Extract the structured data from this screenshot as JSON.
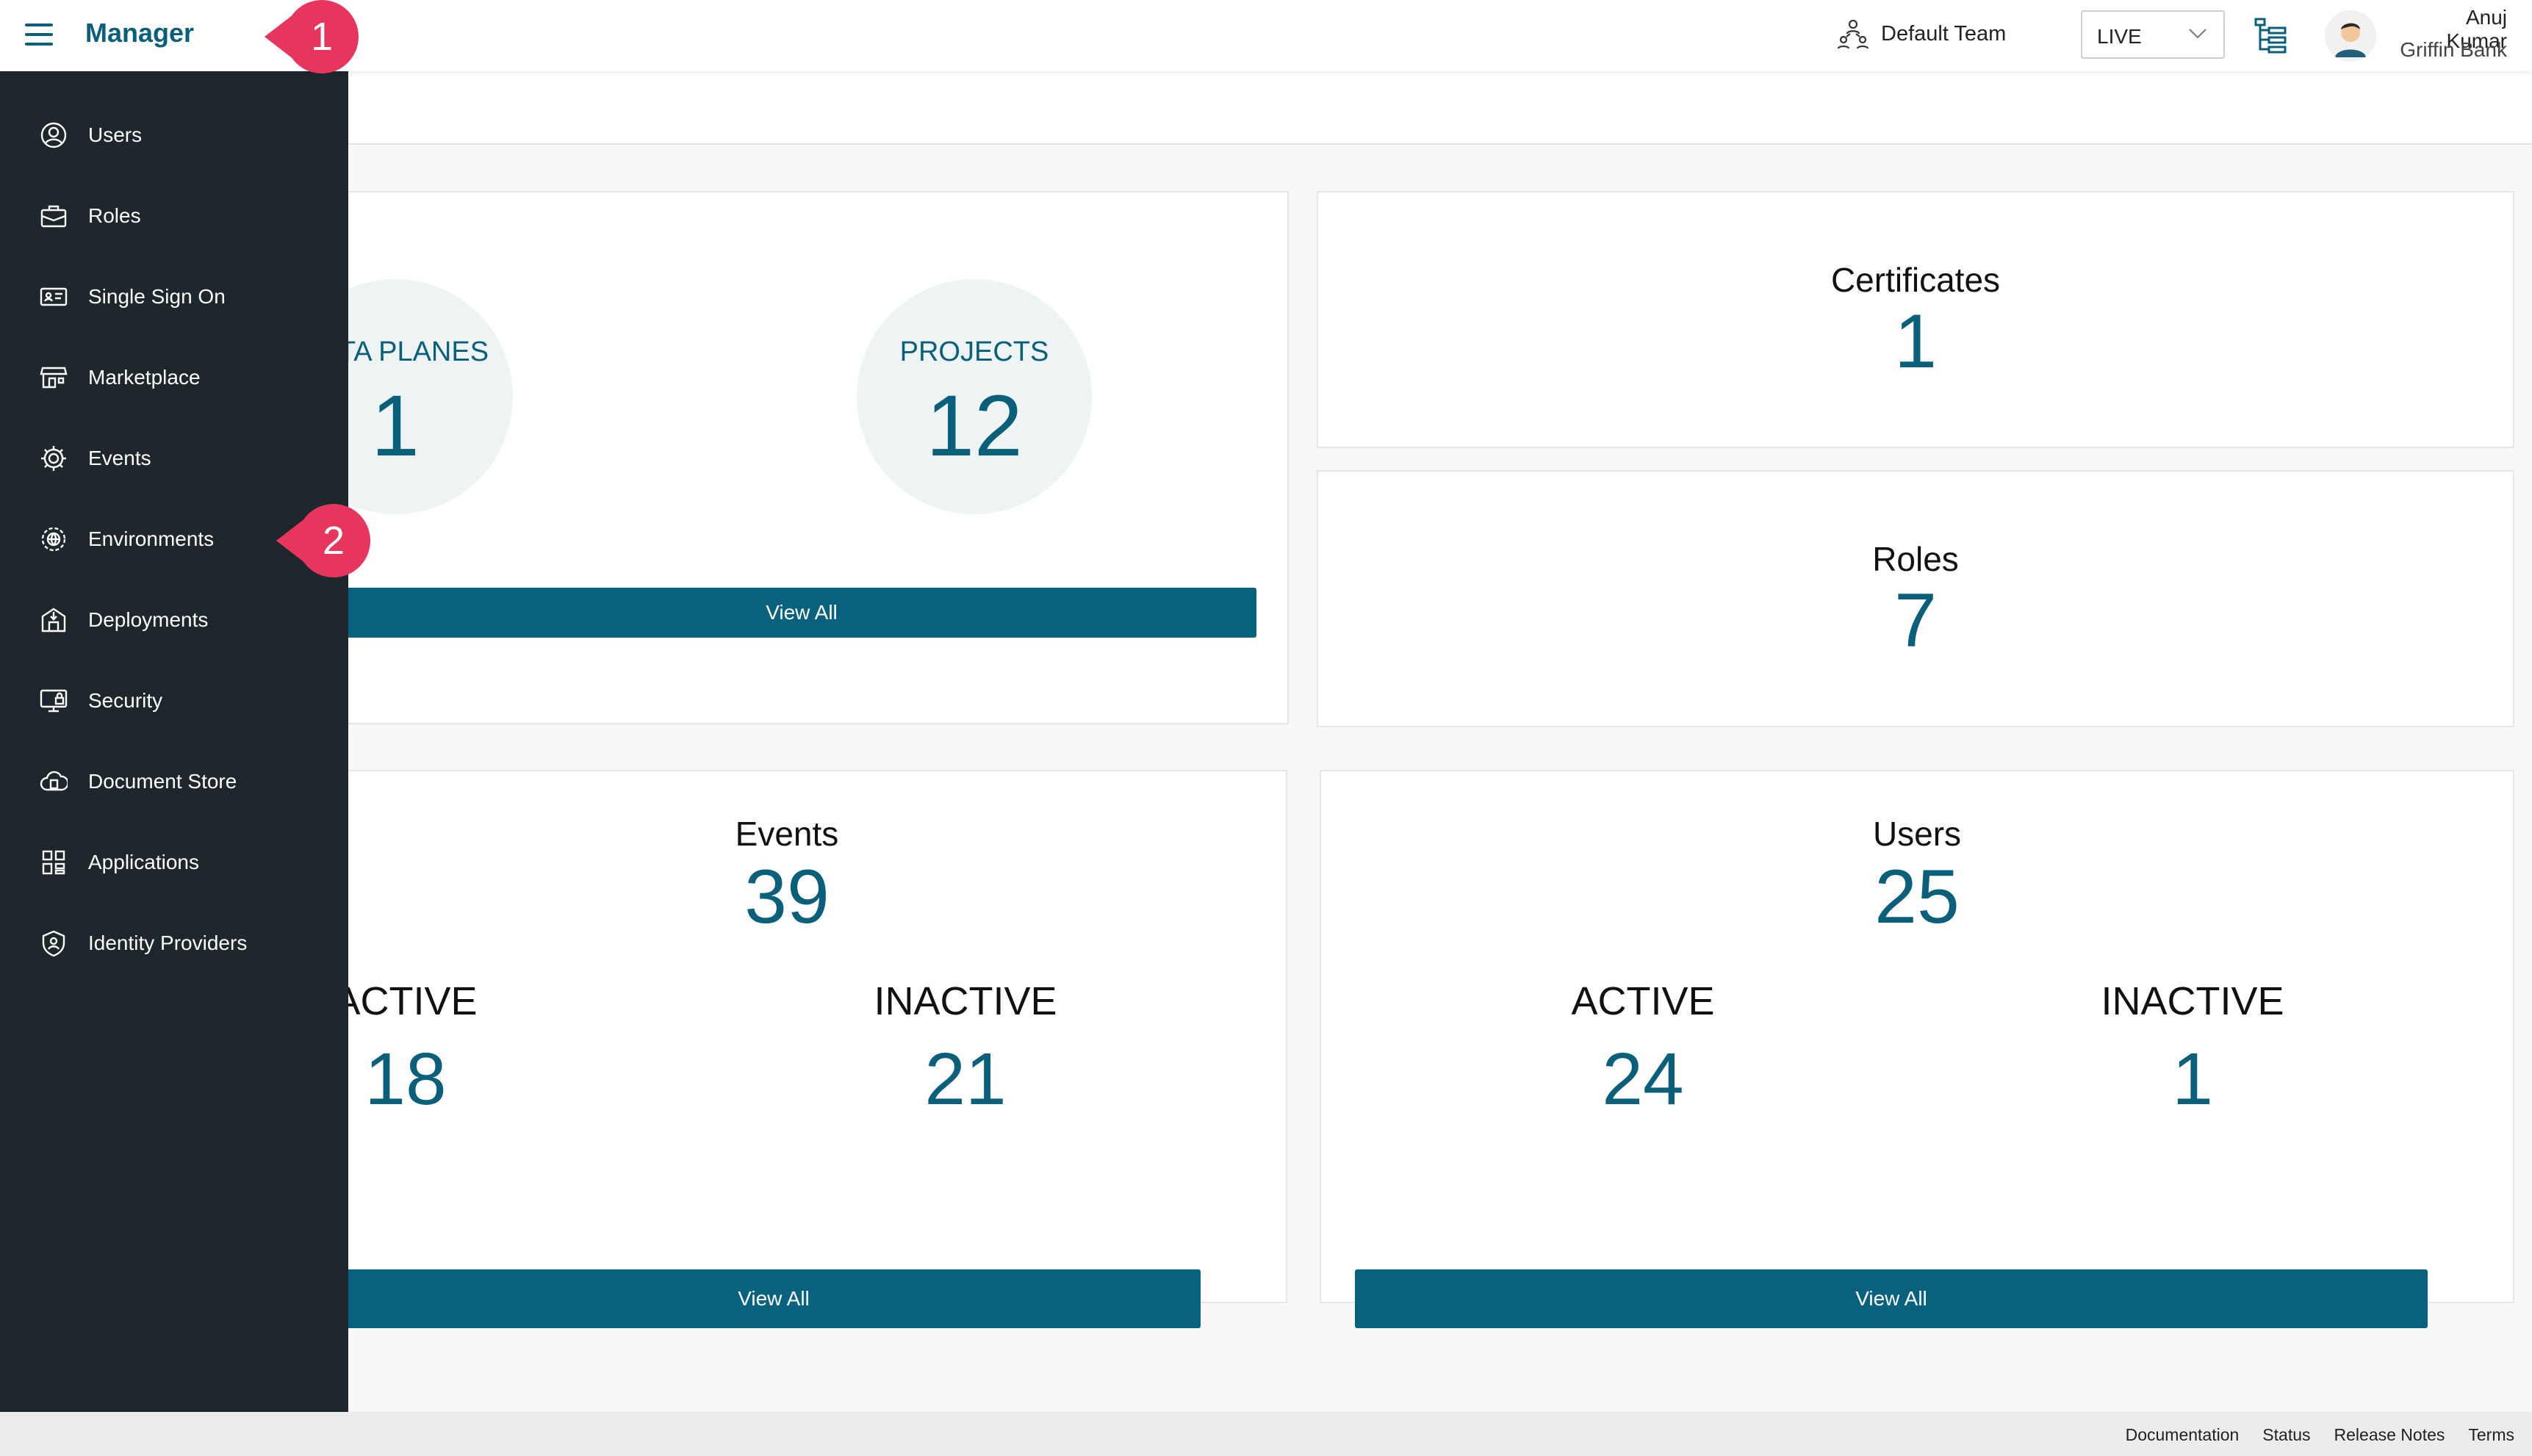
{
  "header": {
    "title": "Manager",
    "team": "Default Team",
    "environment": "LIVE",
    "user_name": "Anuj Kumar",
    "user_org": "Griffin Bank"
  },
  "sidebar": {
    "items": [
      {
        "label": "Users",
        "icon": "user-circle-icon"
      },
      {
        "label": "Roles",
        "icon": "briefcase-icon"
      },
      {
        "label": "Single Sign On",
        "icon": "id-card-icon"
      },
      {
        "label": "Marketplace",
        "icon": "store-icon"
      },
      {
        "label": "Events",
        "icon": "gear-icon"
      },
      {
        "label": "Environments",
        "icon": "globe-gear-icon"
      },
      {
        "label": "Deployments",
        "icon": "deploy-icon"
      },
      {
        "label": "Security",
        "icon": "monitor-lock-icon"
      },
      {
        "label": "Document Store",
        "icon": "cloud-doc-icon"
      },
      {
        "label": "Applications",
        "icon": "apps-grid-icon"
      },
      {
        "label": "Identity Providers",
        "icon": "shield-user-icon"
      }
    ]
  },
  "cards": {
    "data_planes": {
      "label": "DATA PLANES",
      "value": "1"
    },
    "projects": {
      "label": "PROJECTS",
      "value": "12"
    },
    "overview_button": "View All",
    "certificates": {
      "title": "Certificates",
      "value": "1"
    },
    "roles": {
      "title": "Roles",
      "value": "7"
    },
    "events": {
      "title": "Events",
      "value": "39",
      "active_label": "ACTIVE",
      "active_value": "18",
      "inactive_label": "INACTIVE",
      "inactive_value": "21",
      "button": "View All"
    },
    "users": {
      "title": "Users",
      "value": "25",
      "active_label": "ACTIVE",
      "active_value": "24",
      "inactive_label": "INACTIVE",
      "inactive_value": "1",
      "button": "View All"
    }
  },
  "callouts": {
    "first": "1",
    "second": "2"
  },
  "footer": {
    "links": [
      "Documentation",
      "Status",
      "Release Notes",
      "Terms"
    ]
  },
  "colors": {
    "accent": "#0a5f7a",
    "button": "#08617d",
    "sidebar": "#1e272c",
    "callout": "#e8355e"
  }
}
